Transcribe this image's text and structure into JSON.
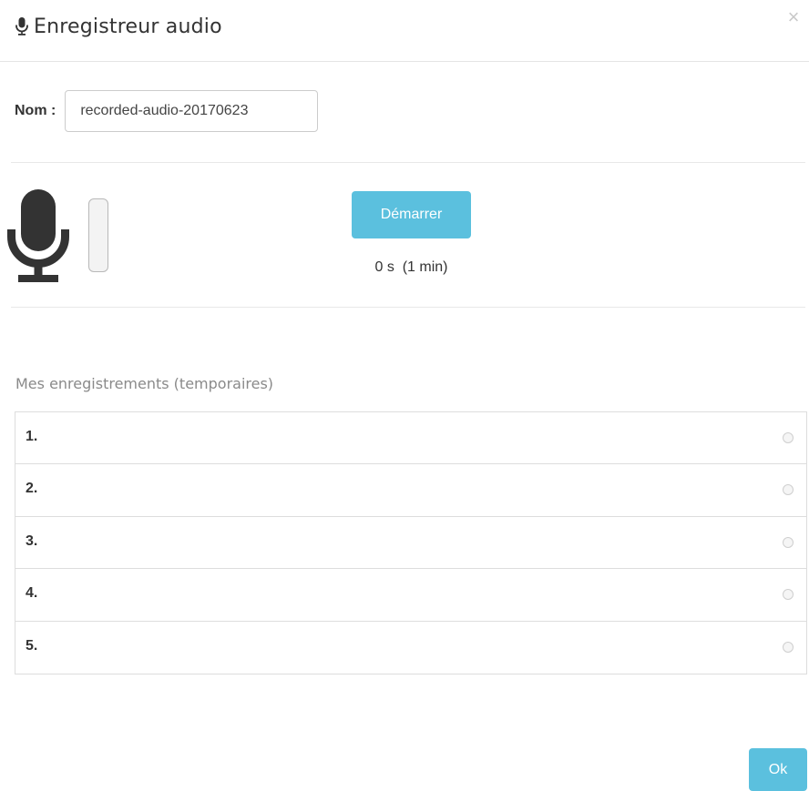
{
  "modal": {
    "title": "Enregistreur audio",
    "title_icon": "microphone-icon",
    "close_label": "×"
  },
  "name_field": {
    "label": "Nom :",
    "value": "recorded-audio-20170623"
  },
  "recorder": {
    "mic_icon": "microphone-icon",
    "level": 0,
    "start_label": "Démarrer",
    "timer_text": "0 s  (1 min)"
  },
  "recordings": {
    "title": "Mes enregistrements (temporaires)",
    "items": [
      {
        "label": "1."
      },
      {
        "label": "2."
      },
      {
        "label": "3."
      },
      {
        "label": "4."
      },
      {
        "label": "5."
      }
    ]
  },
  "footer": {
    "ok_label": "Ok"
  },
  "colors": {
    "accent": "#5bc0de",
    "text": "#333333",
    "muted": "#8a8a8a",
    "border": "#dddddd"
  }
}
